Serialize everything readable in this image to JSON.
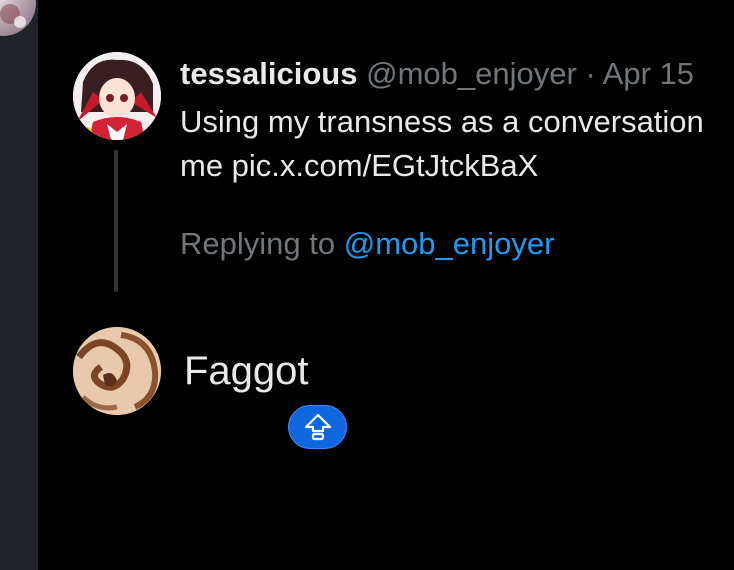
{
  "quoted_tweet": {
    "display_name": "tessalicious",
    "handle": "@mob_enjoyer",
    "separator": "·",
    "date": "Apr 15",
    "text_line1": "Using my transness as a conversation",
    "text_line2": "me pic.x.com/EGtJtckBaX"
  },
  "reply_context": {
    "label": "Replying to",
    "mention": "@mob_enjoyer"
  },
  "reply": {
    "text": "Faggot"
  },
  "icons": {
    "upvote": "upvote-arrow-icon"
  },
  "colors": {
    "background": "#000000",
    "sidebar": "#202327",
    "primary_text": "#e7e9ea",
    "secondary_text": "#71767b",
    "link": "#1d9bf0",
    "button": "#0f67e0"
  }
}
